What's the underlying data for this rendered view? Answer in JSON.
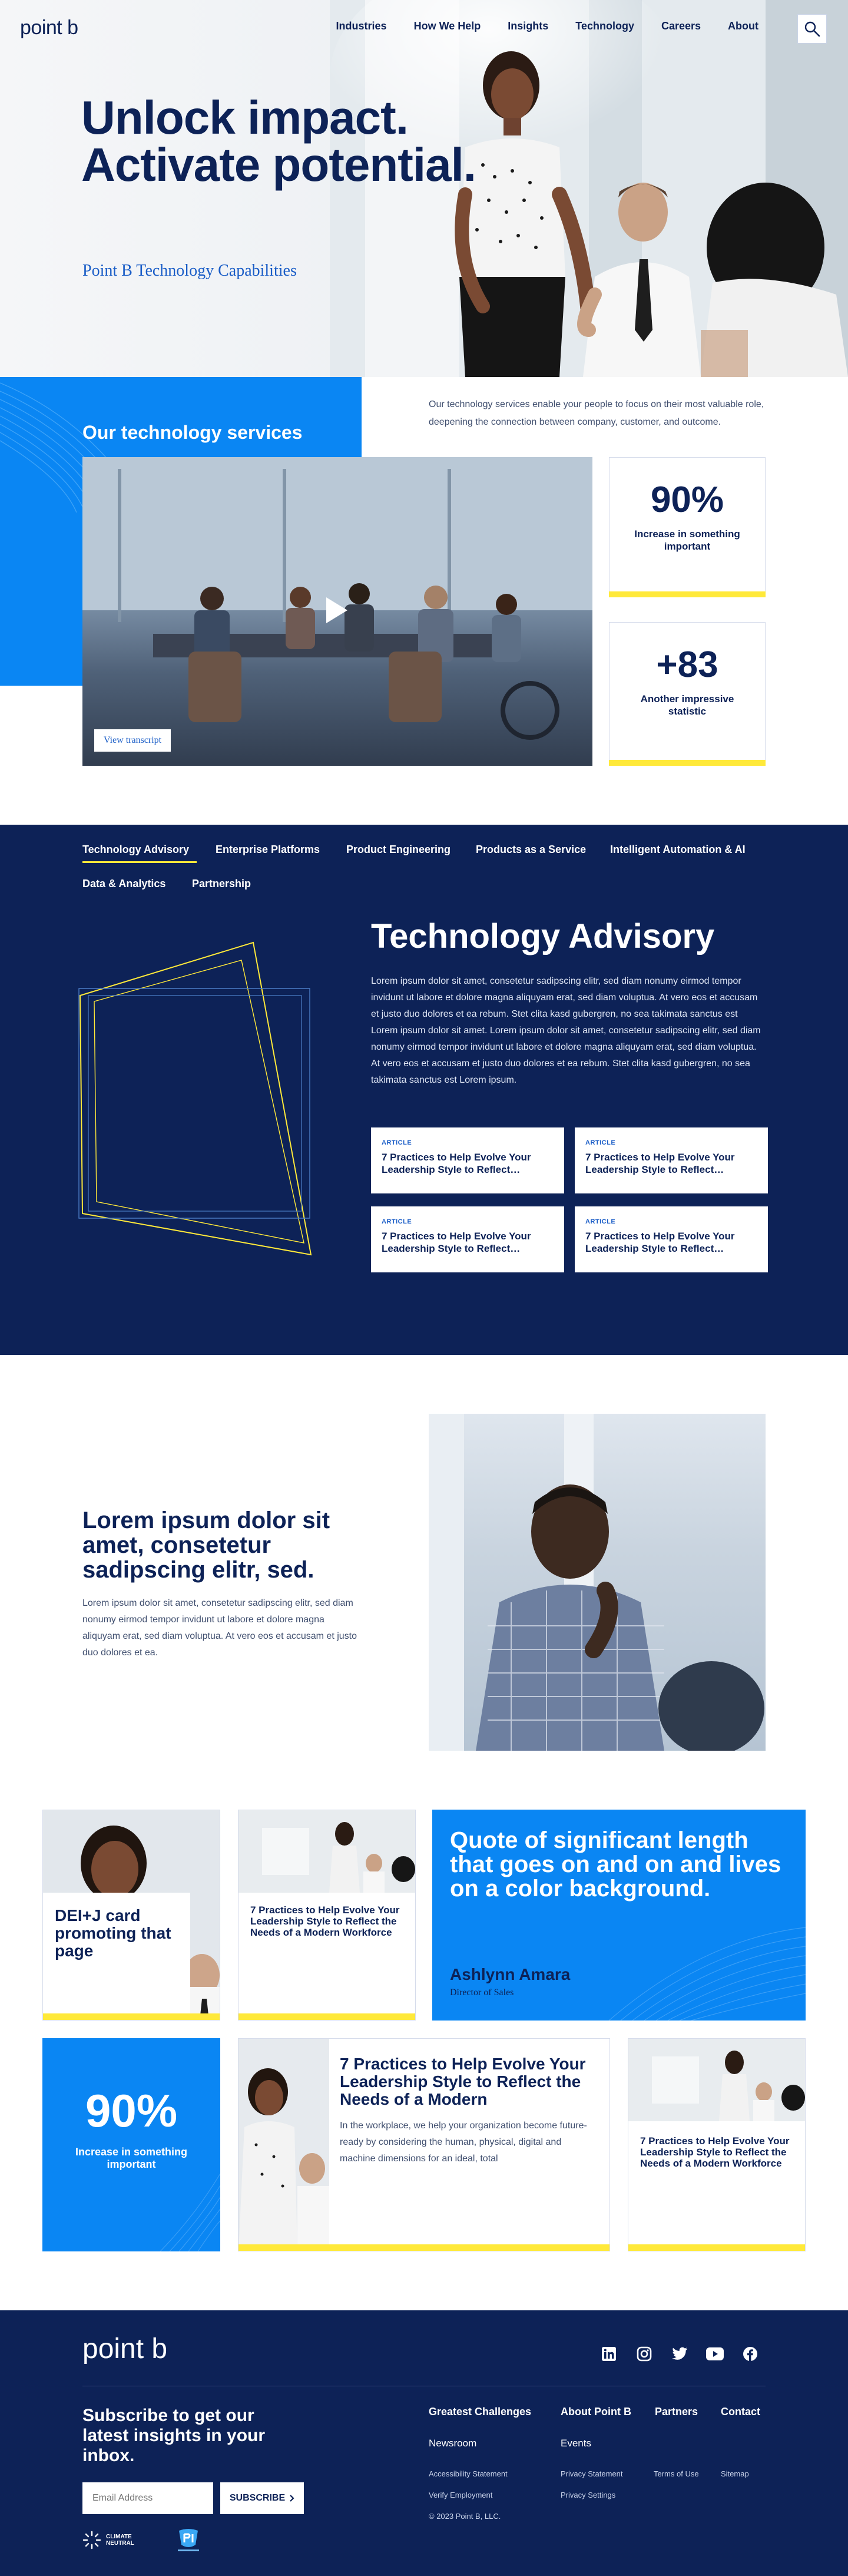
{
  "header": {
    "logo": "point b",
    "nav": [
      "Industries",
      "How We Help",
      "Insights",
      "Technology",
      "Careers",
      "About"
    ]
  },
  "hero": {
    "title": "Unlock impact. Activate potential.",
    "subtitle": "Point B Technology Capabilities"
  },
  "services": {
    "title": "Our technology services",
    "description": "Our technology services enable your people to focus on their most valuable role, deepening the connection between company, customer, and outcome.",
    "video_transcript_label": "View transcript",
    "stats": [
      {
        "value": "90%",
        "label": "Increase in something important"
      },
      {
        "value": "+83",
        "label": "Another impressive statistic"
      }
    ]
  },
  "tech": {
    "tabs": [
      "Technology Advisory",
      "Enterprise Platforms",
      "Product Engineering",
      "Products as a Service",
      "Intelligent Automation & AI",
      "Data & Analytics",
      "Partnership"
    ],
    "title": "Technology Advisory",
    "body": "Lorem ipsum dolor sit amet, consetetur sadipscing elitr, sed diam nonumy eirmod tempor invidunt ut labore et dolore magna aliquyam erat, sed diam voluptua. At vero eos et accusam et justo duo dolores et ea rebum. Stet clita kasd gubergren, no sea takimata sanctus est Lorem ipsum dolor sit amet. Lorem ipsum dolor sit amet, consetetur sadipscing elitr, sed diam nonumy eirmod tempor invidunt ut labore et dolore magna aliquyam erat, sed diam voluptua. At vero eos et accusam et justo duo dolores et ea rebum. Stet clita kasd gubergren, no sea takimata sanctus est Lorem ipsum.",
    "articles": [
      {
        "tag": "ARTICLE",
        "title": "7 Practices to Help Evolve Your Leadership Style to Reflect…"
      },
      {
        "tag": "ARTICLE",
        "title": "7 Practices to Help Evolve Your Leadership Style to Reflect…"
      },
      {
        "tag": "ARTICLE",
        "title": "7 Practices to Help Evolve Your Leadership Style to Reflect…"
      },
      {
        "tag": "ARTICLE",
        "title": "7 Practices to Help Evolve Your Leadership Style to Reflect…"
      }
    ]
  },
  "feature": {
    "title": "Lorem ipsum dolor sit amet, consetetur sadipscing elitr, sed.",
    "body": "Lorem ipsum dolor sit amet, consetetur sadipscing elitr, sed diam nonumy eirmod tempor invidunt ut labore et dolore magna aliquyam erat, sed diam voluptua. At vero eos et accusam et justo duo dolores et ea."
  },
  "grid": {
    "card1_title": "DEI+J card promoting that page",
    "card2_title": "7 Practices to Help Evolve Your Leadership Style to Reflect the Needs of a Modern Workforce",
    "quote": "Quote of significant length that goes on and on and lives on a color background.",
    "quote_author": "Ashlynn Amara",
    "quote_role": "Director of Sales",
    "stat_value": "90%",
    "stat_label": "Increase in something important",
    "wide_title": "7 Practices to Help Evolve Your Leadership Style to Reflect the Needs of a Modern",
    "wide_body": "In the workplace, we help your organization become future-ready by considering the human, physical, digital and machine dimensions for an ideal, total",
    "card6_title": "7 Practices to Help Evolve Your Leadership Style to Reflect the Needs of a Modern Workforce"
  },
  "footer": {
    "logo": "point b",
    "subscribe_title": "Subscribe to get our latest insights in your inbox.",
    "email_placeholder": "Email Address",
    "subscribe_button": "SUBSCRIBE",
    "climate_label": "CLIMATE NEUTRAL",
    "columns": [
      "Greatest Challenges",
      "About Point B",
      "Partners",
      "Contact"
    ],
    "links": [
      "Newsroom",
      "Events"
    ],
    "small_links": [
      "Accessibility Statement",
      "Privacy Statement",
      "Terms of Use",
      "Sitemap",
      "Verify Employment",
      "Privacy Settings"
    ],
    "copyright": "© 2023 Point B, LLC."
  },
  "colors": {
    "navy": "#0d2257",
    "blue": "#0a86f3",
    "yellow": "#ffe93a"
  }
}
